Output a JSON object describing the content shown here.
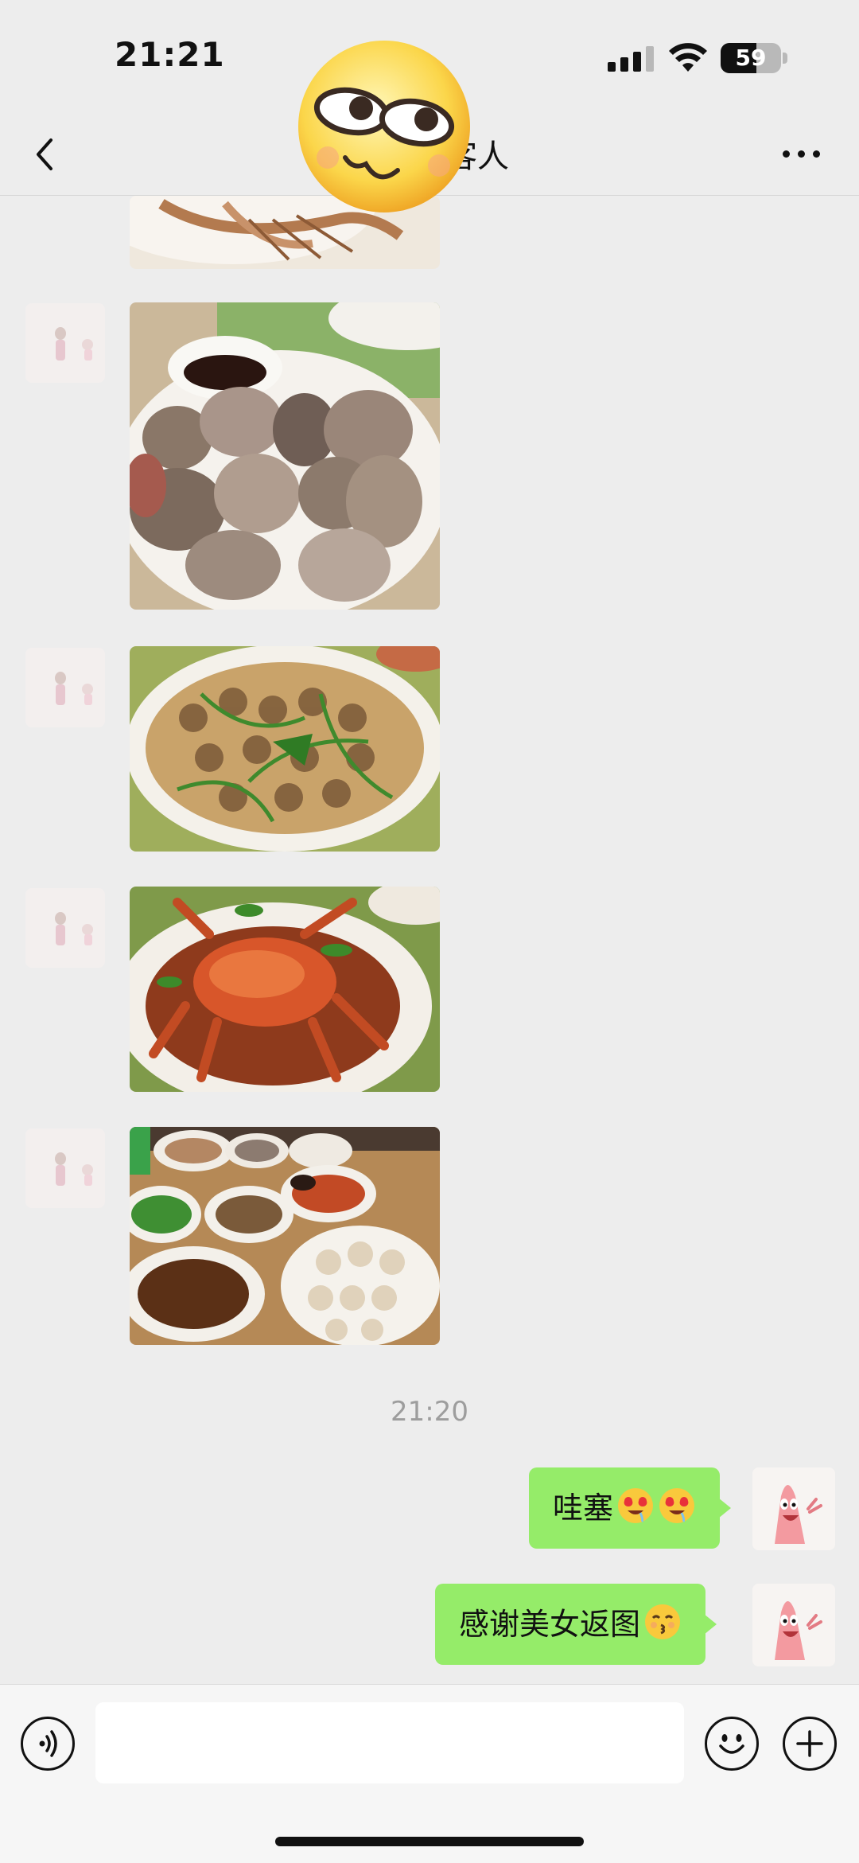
{
  "status_bar": {
    "time": "21:21",
    "battery_level": "59",
    "battery_fraction": 0.59
  },
  "nav": {
    "title": "客人",
    "back_icon": "chevron-left-icon",
    "more_icon": "ellipsis-icon"
  },
  "sticker": {
    "icon": "smirking-face-sticker"
  },
  "messages": {
    "incoming_photos": [
      {
        "subject": "fried shrimp dish"
      },
      {
        "subject": "steamed conch with soy sauce"
      },
      {
        "subject": "stir-fried spotted snails"
      },
      {
        "subject": "spicy crab"
      },
      {
        "subject": "seafood table spread"
      }
    ],
    "timestamp": "21:20",
    "outgoing": [
      {
        "text": "哇塞",
        "emoji": [
          "heart-eyes-drooling-emoji",
          "heart-eyes-drooling-emoji"
        ]
      },
      {
        "text": "感谢美女返图",
        "emoji": [
          "kissing-emoji"
        ]
      }
    ]
  },
  "input_bar": {
    "placeholder": "",
    "voice_icon": "voice-icon",
    "emoji_icon": "smiley-icon",
    "plus_icon": "plus-icon"
  },
  "colors": {
    "background": "#ededed",
    "bubble_out": "#95ec69",
    "timestamp": "#9d9d9d"
  }
}
